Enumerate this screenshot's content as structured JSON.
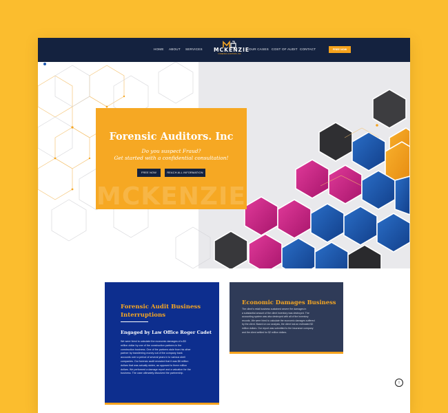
{
  "nav": {
    "links": [
      "HOME",
      "ABOUT",
      "SERVICES",
      "OUR CASES",
      "COST OF AUDIT",
      "CONTACT"
    ],
    "cta": "FREE NOW"
  },
  "logo": {
    "name": "MCKENZIE",
    "tagline": "FORENSIC AUDITORS, INC"
  },
  "hero": {
    "title": "Forensic Auditors. Inc",
    "subtitle_line1": "Do you suspect Fraud?",
    "subtitle_line2": "Get started with a confidential consultation!",
    "button_primary": "FREE NOW",
    "button_secondary": "REACH ALL INFORMATION",
    "watermark": "MCKENZIE"
  },
  "case1": {
    "title_line1": "Forensic Audit Business",
    "title_line2": "Interruptions",
    "subtitle": "Engaged by Law Office Roger Cadet",
    "lines": [
      "We were hired to calculate the economic damages of a $3",
      "million dollar by one of the construction partners in the",
      "construction business. One of the partners stole from his other",
      "partner by transferring money out of the company bank",
      "accounts over a period of several years in to various shell",
      "companies. Our forensic audit revealed that it was $6 million",
      "dollars that was actually stolen, as opposed to three million",
      "dollars. We performed a damage report and a valuation for the",
      "business. The case ultimately dissolved the partnership."
    ]
  },
  "case2": {
    "title": "Economic Damages Business",
    "lines": [
      "The client's retail business sustained severe fire damages in",
      "a substantial amount of the client inventory was destroyed. The",
      "accounting system was also destroyed with all of the inventory",
      "records. We were hired to calculate the economic damages suffered",
      "by the client. Based on our analysis, the client lost an estimated $2",
      "million dollars. Our report was submitted to the insurance company",
      "and the client settled for $2 million dollars."
    ]
  },
  "icons": [
    "logo-icon",
    "hexagon-pattern",
    "arrow-up-icon"
  ],
  "colors": {
    "background": "#fbbd2e",
    "navy": "#14223f",
    "accent": "#f5a21c",
    "case1": "#0d2e8e",
    "case2": "#2f3b58",
    "magenta": "#d42a8f",
    "blue": "#1e5ab4"
  }
}
